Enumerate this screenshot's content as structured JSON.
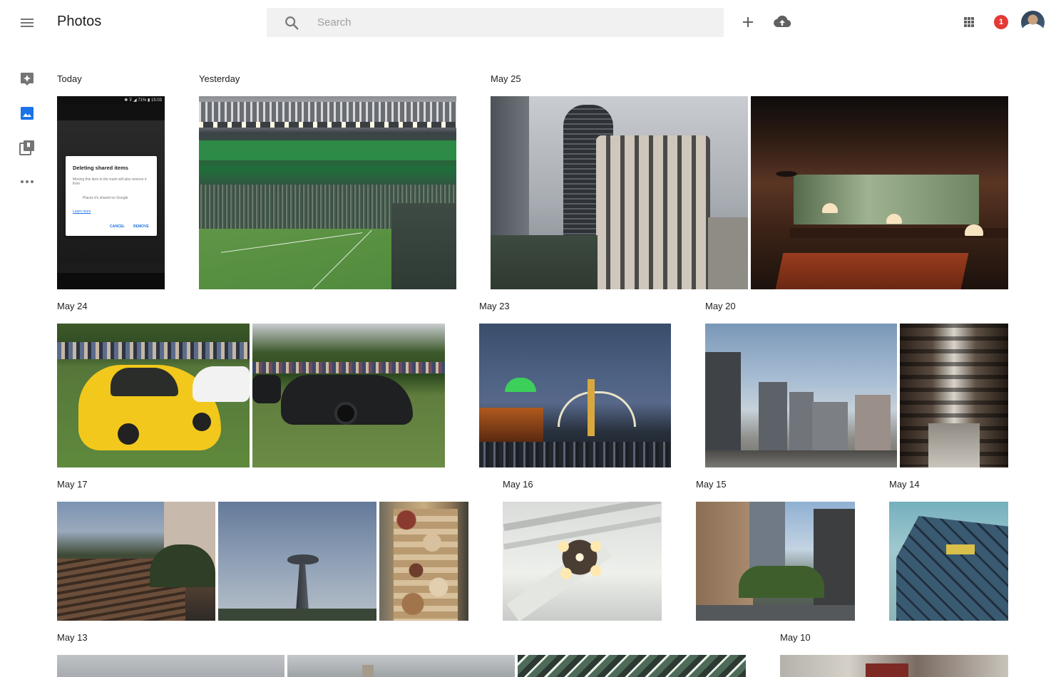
{
  "app": {
    "title": "Photos"
  },
  "search": {
    "placeholder": "Search"
  },
  "notifications": {
    "count": "1"
  },
  "sections": [
    {
      "date": "Today"
    },
    {
      "date": "Yesterday"
    },
    {
      "date": "May 25"
    },
    {
      "date": "May 24"
    },
    {
      "date": "May 23"
    },
    {
      "date": "May 20"
    },
    {
      "date": "May 17"
    },
    {
      "date": "May 16"
    },
    {
      "date": "May 15"
    },
    {
      "date": "May 14"
    },
    {
      "date": "May 13"
    },
    {
      "date": "May 10"
    }
  ],
  "phone_screenshot": {
    "status": "✱ ⊽ ◢ 71% ▮ 15:03",
    "dialog_title": "Deleting shared items",
    "dialog_body": "Moving this item to the trash will also remove it from",
    "dialog_row": "Places it's shared on Google",
    "dialog_link": "Learn more",
    "cancel": "CANCEL",
    "remove": "REMOVE"
  },
  "colors": {
    "accent": "#1a73e8",
    "badge": "#e53935",
    "icon_grey": "#757575"
  }
}
